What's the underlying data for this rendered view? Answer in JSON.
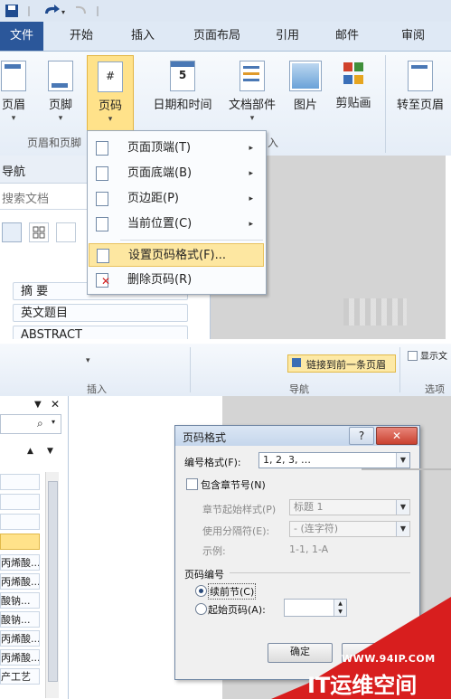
{
  "top": {
    "tabs": [
      "文件",
      "开始",
      "插入",
      "页面布局",
      "引用",
      "邮件",
      "审阅"
    ],
    "ribbon_buttons": [
      {
        "label": "页眉",
        "icon": "header-icon"
      },
      {
        "label": "页脚",
        "icon": "footer-icon"
      },
      {
        "label": "页码",
        "icon": "page-number-icon"
      },
      {
        "label": "日期和时间",
        "icon": "calendar-icon"
      },
      {
        "label": "文档部件",
        "icon": "document-parts-icon"
      },
      {
        "label": "图片",
        "icon": "picture-icon"
      },
      {
        "label": "剪贴画",
        "icon": "clipart-icon"
      },
      {
        "label": "转至页眉",
        "icon": "goto-header-icon"
      }
    ],
    "group_label": "页眉和页脚",
    "group_label_insert": "入",
    "nav_title": "导航",
    "nav_search_placeholder": "搜索文档",
    "nav_items": [
      "摘  要",
      "英文题目",
      "ABSTRACT"
    ],
    "menu_items": [
      {
        "label": "页面顶端(T)",
        "submenu": true,
        "highlight": false
      },
      {
        "label": "页面底端(B)",
        "submenu": true,
        "highlight": false
      },
      {
        "label": "页边距(P)",
        "submenu": true,
        "highlight": false
      },
      {
        "label": "当前位置(C)",
        "submenu": true,
        "highlight": false
      },
      {
        "label": "设置页码格式(F)...",
        "submenu": false,
        "highlight": true
      },
      {
        "label": "删除页码(R)",
        "submenu": false,
        "highlight": false
      }
    ],
    "submenu_arrow": "▸"
  },
  "bottom": {
    "group_insert": "插入",
    "group_nav": "导航",
    "group_options": "选项",
    "link_prev_button": "链接到前一条页眉",
    "show_doc_text": "显示文",
    "nav_items": [
      "丙烯酸...",
      "丙烯酸...",
      "酸钠...",
      "酸钠...",
      "丙烯酸...",
      "丙烯酸...",
      "产工艺"
    ],
    "dialog": {
      "title": "页码格式",
      "help": "?",
      "close": "✕",
      "number_format_label": "编号格式(F):",
      "number_format_value": "1, 2, 3, …",
      "include_chapter_label": "包含章节号(N)",
      "chapter_start_label": "章节起始样式(P)",
      "chapter_start_value": "标题 1",
      "separator_label": "使用分隔符(E):",
      "separator_value": "-  (连字符)",
      "example_label": "示例:",
      "example_value": "1-1, 1-A",
      "page_numbering_label": "页码编号",
      "continue_label": "续前节(C)",
      "start_at_label": "起始页码(A):",
      "ok_label": "确定"
    }
  },
  "watermark": {
    "url": "WWW.94IP.COM",
    "brand": "IT运维空间"
  },
  "colors": {
    "file_tab": "#2b579a",
    "highlight": "#ffe28a",
    "watermark_red": "#d81e1e"
  }
}
